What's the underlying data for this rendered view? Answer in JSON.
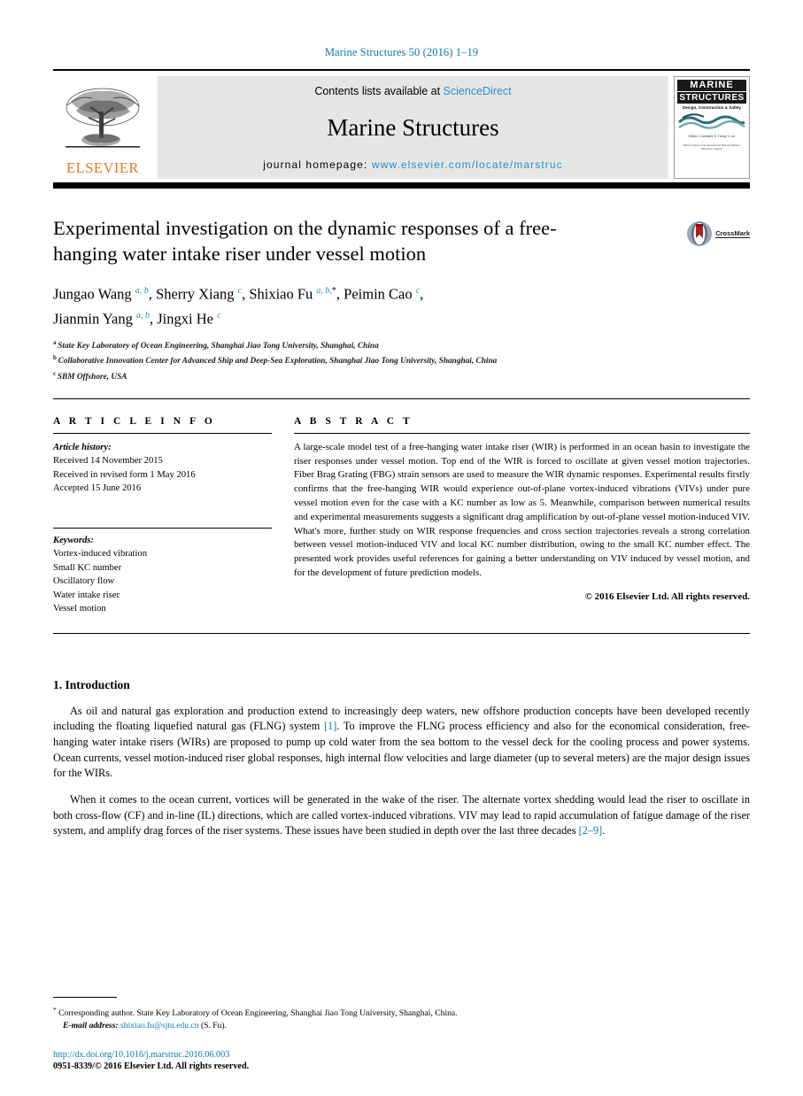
{
  "running_head": "Marine Structures 50 (2016) 1–19",
  "masthead": {
    "contents_prefix": "Contents lists available at",
    "sciencedirect": "ScienceDirect",
    "journal_name": "Marine Structures",
    "homepage_prefix": "journal homepage:",
    "homepage_url": "www.elsevier.com/locate/marstruc",
    "publisher": "ELSEVIER",
    "cover": {
      "line1": "MARINE",
      "line2": "STRUCTURES",
      "tagline": "Design, Construction & Safety",
      "editors": "Editor\nJ. Amdahl\nS. Hong\nY. Liu",
      "footer": "Official Journal of the International Ship and Offshore Structures Congress"
    }
  },
  "article": {
    "title": "Experimental investigation on the dynamic responses of a free-hanging water intake riser under vessel motion",
    "crossmark_label": "CrossMark",
    "authors": [
      {
        "name": "Jungao Wang",
        "marks": "a, b",
        "star": false,
        "sep": ", "
      },
      {
        "name": "Sherry Xiang",
        "marks": "c",
        "star": false,
        "sep": ", "
      },
      {
        "name": "Shixiao Fu",
        "marks": "a, b,",
        "star": true,
        "sep": ", "
      },
      {
        "name": "Peimin Cao",
        "marks": "c",
        "star": false,
        "sep": ","
      },
      {
        "name": "Jianmin Yang",
        "marks": "a, b",
        "star": false,
        "sep": ", "
      },
      {
        "name": "Jingxi He",
        "marks": "c",
        "star": false,
        "sep": ""
      }
    ],
    "affiliations": [
      {
        "mark": "a",
        "text": "State Key Laboratory of Ocean Engineering, Shanghai Jiao Tong University, Shanghai, China"
      },
      {
        "mark": "b",
        "text": "Collaborative Innovation Center for Advanced Ship and Deep-Sea Exploration, Shanghai Jiao Tong University, Shanghai, China"
      },
      {
        "mark": "c",
        "text": "SBM Offshore, USA"
      }
    ]
  },
  "article_info": {
    "heading": "A R T I C L E   I N F O",
    "history_label": "Article history:",
    "history": [
      "Received 14 November 2015",
      "Received in revised form 1 May 2016",
      "Accepted 15 June 2016"
    ],
    "keywords_label": "Keywords:",
    "keywords": [
      "Vortex-induced vibration",
      "Small KC number",
      "Oscillatory flow",
      "Water intake riser",
      "Vessel motion"
    ]
  },
  "abstract": {
    "heading": "A B S T R A C T",
    "text": "A large-scale model test of a free-hanging water intake riser (WIR) is performed in an ocean basin to investigate the riser responses under vessel motion. Top end of the WIR is forced to oscillate at given vessel motion trajectories. Fiber Brag Grating (FBG) strain sensors are used to measure the WIR dynamic responses. Experimental results firstly confirms that the free-hanging WIR would experience out-of-plane vortex-induced vibrations (VIVs) under pure vessel motion even for the case with a KC number as low as 5. Meanwhile, comparison between numerical results and experimental measurements suggests a significant drag amplification by out-of-plane vessel motion-induced VIV. What's more, further study on WIR response frequencies and cross section trajectories reveals a strong correlation between vessel motion-induced VIV and local KC number distribution, owing to the small KC number effect. The presented work provides useful references for gaining a better understanding on VIV induced by vessel motion, and for the development of future prediction models.",
    "copyright": "© 2016 Elsevier Ltd. All rights reserved."
  },
  "introduction": {
    "heading": "1. Introduction",
    "paragraph1_a": "As oil and natural gas exploration and production extend to increasingly deep waters, new offshore production concepts have been developed recently including the floating liquefied natural gas (FLNG) system ",
    "paragraph1_cite": "[1]",
    "paragraph1_b": ". To improve the FLNG process efficiency and also for the economical consideration, free-hanging water intake risers (WIRs) are proposed to pump up cold water from the sea bottom to the vessel deck for the cooling process and power systems. Ocean currents, vessel motion-induced riser global responses, high internal flow velocities and large diameter (up to several meters) are the major design issues for the WIRs.",
    "paragraph2_a": "When it comes to the ocean current, vortices will be generated in the wake of the riser. The alternate vortex shedding would lead the riser to oscillate in both cross-flow (CF) and in-line (IL) directions, which are called vortex-induced vibrations. VIV may lead to rapid accumulation of fatigue damage of the riser system, and amplify drag forces of the riser systems. These issues have been studied in depth over the last three decades ",
    "paragraph2_cite": "[2–9]",
    "paragraph2_b": "."
  },
  "footer": {
    "corresponding_mark": "*",
    "corresponding_text": "Corresponding author. State Key Laboratory of Ocean Engineering, Shanghai Jiao Tong University, Shanghai, China.",
    "email_label": "E-mail address:",
    "email": "shixiao.fu@sjtu.edu.cn",
    "email_suffix": "(S. Fu).",
    "doi": "http://dx.doi.org/10.1016/j.marstruc.2016.06.003",
    "issn": "0951-8339/© 2016 Elsevier Ltd. All rights reserved."
  },
  "colors": {
    "link": "#0b7ba8",
    "sciencedirect": "#2b8fc4",
    "elsevier_orange": "#E87722"
  }
}
